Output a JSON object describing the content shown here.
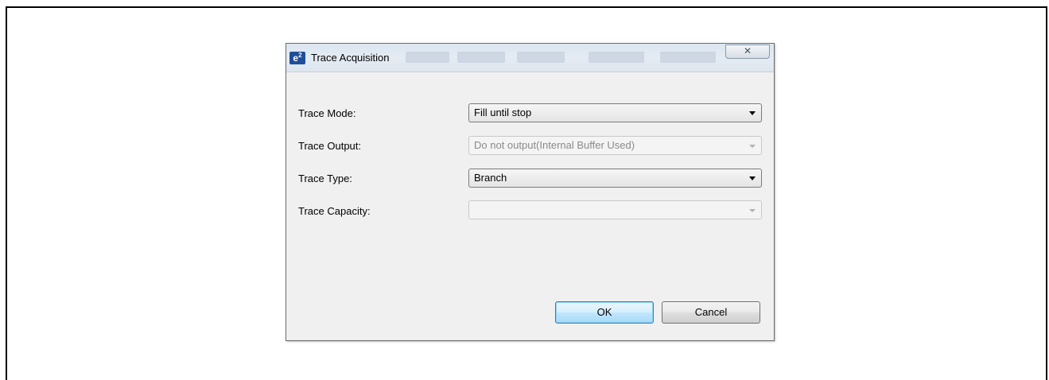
{
  "dialog": {
    "title": "Trace Acquisition",
    "app_icon": {
      "name": "e2-app-icon",
      "text": "e",
      "sup": "2"
    },
    "close_glyph": "✕",
    "fields": [
      {
        "label": "Trace Mode:",
        "value": "Fill until stop",
        "enabled": true
      },
      {
        "label": "Trace Output:",
        "value": "Do not output(Internal Buffer Used)",
        "enabled": false
      },
      {
        "label": "Trace Type:",
        "value": "Branch",
        "enabled": true
      },
      {
        "label": "Trace Capacity:",
        "value": "",
        "enabled": false
      }
    ],
    "ok_label": "OK",
    "cancel_label": "Cancel"
  },
  "colors": {
    "ok_button_border": "#3c7fb1",
    "dialog_background": "#f0f0f0",
    "icon_background": "#1f4f9a"
  }
}
